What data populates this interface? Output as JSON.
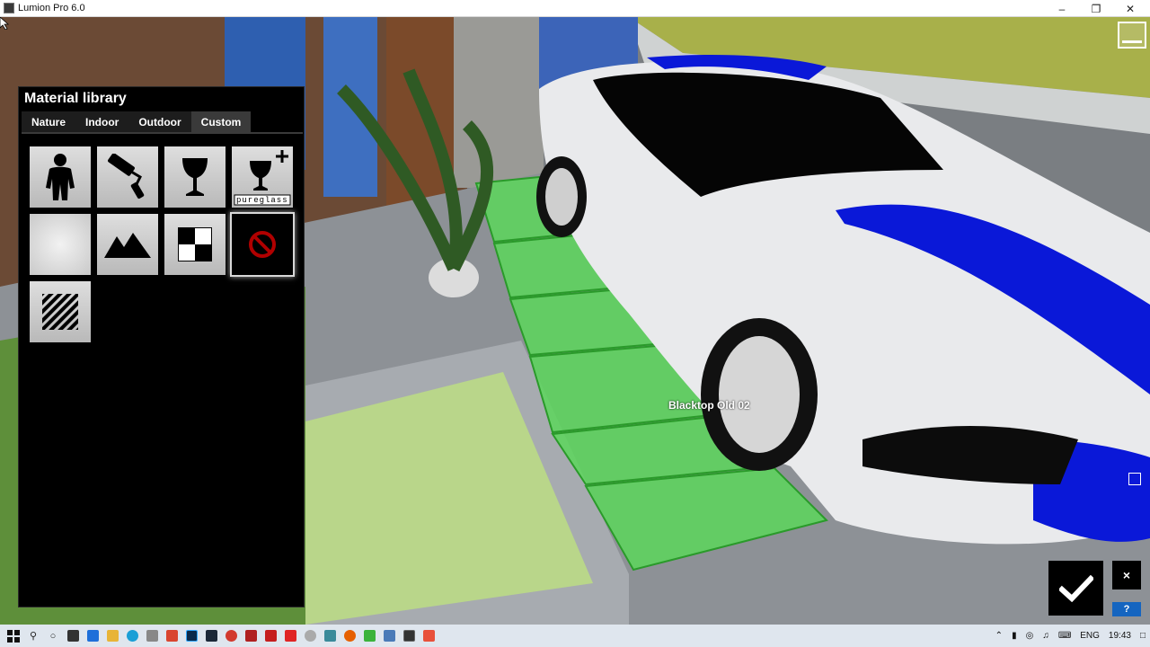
{
  "window": {
    "title": "Lumion Pro 6.0"
  },
  "material_library": {
    "title": "Material library",
    "tabs": [
      "Nature",
      "Indoor",
      "Outdoor",
      "Custom"
    ],
    "active_tab": "Custom",
    "tiles": [
      {
        "icon": "person-icon"
      },
      {
        "icon": "paint-roller-icon"
      },
      {
        "icon": "glass-icon"
      },
      {
        "icon": "pureglass-icon",
        "caption": "pureglass"
      },
      {
        "icon": "blank-icon"
      },
      {
        "icon": "landscape-icon"
      },
      {
        "icon": "checker-icon"
      },
      {
        "icon": "no-material-icon",
        "selected": true
      },
      {
        "icon": "stripes-icon"
      }
    ]
  },
  "viewport": {
    "pick_label": "Blacktop Old 02"
  },
  "controls": {
    "close_glyph": "×",
    "help_glyph": "?"
  },
  "taskbar": {
    "language": "ENG",
    "time": "19:43"
  },
  "colors": {
    "selection_green": "#3ecf3e",
    "car_stripe": "#0a18d8",
    "help_blue": "#1565c0"
  }
}
